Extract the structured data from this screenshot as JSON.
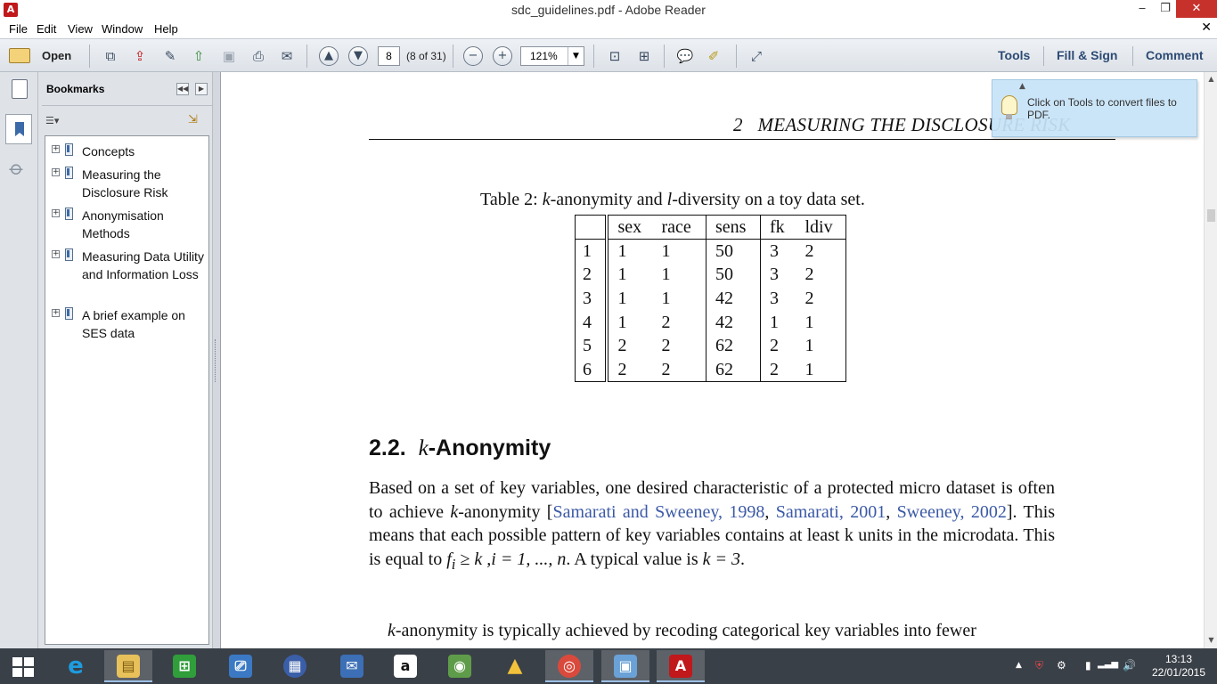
{
  "window": {
    "title": "sdc_guidelines.pdf - Adobe Reader",
    "app_icon_glyph": "A",
    "minimize_glyph": "‒",
    "restore_glyph": "❐",
    "close_glyph": "✕"
  },
  "menu": {
    "items": [
      "File",
      "Edit",
      "View",
      "Window",
      "Help"
    ],
    "close_glyph": "✕"
  },
  "toolbar": {
    "open_label": "Open",
    "page_value": "8",
    "page_count": "(8 of 31)",
    "zoom_value": "121%",
    "zoom_dropdown_glyph": "▼",
    "icons": [
      "create-pdf-icon",
      "export-pdf-icon",
      "edit-icon",
      "upload-icon",
      "save-icon",
      "print-icon",
      "email-icon",
      "previous-page-icon",
      "next-page-icon",
      "zoom-out-icon",
      "zoom-in-icon",
      "fit-page-icon",
      "fit-width-icon",
      "comment-icon",
      "highlight-icon",
      "fullscreen-icon"
    ],
    "glyphs": {
      "prev": "▲",
      "next": "▼",
      "zoom_out": "−",
      "zoom_in": "+",
      "create": "⧉",
      "export": "⇪",
      "edit": "✎",
      "upload": "⇧",
      "save": "▣",
      "print": "⎙",
      "email": "✉",
      "fit_page": "⊡",
      "fit_width": "⊞",
      "comment": "💬",
      "highlight": "✐",
      "fullscreen": "⤢"
    },
    "right_panels": [
      "Tools",
      "Fill & Sign",
      "Comment"
    ]
  },
  "bookmarks": {
    "title": "Bookmarks",
    "collapse_glyph": "◀◀",
    "expand_glyph": "▶",
    "options_glyph": "☰▾",
    "find_glyph": "⇲",
    "expand_item_glyph": "+",
    "items": [
      {
        "label": "Concepts"
      },
      {
        "label": "Measuring the Disclosure Risk"
      },
      {
        "label": "Anonymisation Methods"
      },
      {
        "label": "Measuring Data Utility and Information Loss"
      },
      {
        "label": "A brief example on SES data"
      }
    ]
  },
  "document": {
    "running_head": "2   MEASURING THE DISCLOSURE RISK",
    "caption_prefix": "Table 2: ",
    "caption_k": "k",
    "caption_mid": "-anonymity and ",
    "caption_l": "l",
    "caption_suffix": "-diversity on a toy data set.",
    "table": {
      "headers": [
        "",
        "sex",
        "race",
        "sens",
        "fk",
        "ldiv"
      ],
      "rows": [
        [
          "1",
          "1",
          "1",
          "50",
          "3",
          "2"
        ],
        [
          "2",
          "1",
          "1",
          "50",
          "3",
          "2"
        ],
        [
          "3",
          "1",
          "1",
          "42",
          "3",
          "2"
        ],
        [
          "4",
          "1",
          "2",
          "42",
          "1",
          "1"
        ],
        [
          "5",
          "2",
          "2",
          "62",
          "2",
          "1"
        ],
        [
          "6",
          "2",
          "2",
          "62",
          "2",
          "1"
        ]
      ]
    },
    "section_number": "2.2.",
    "section_k": "k",
    "section_title": "-Anonymity",
    "para1": {
      "t1": "Based on a set of key variables, one desired characteristic of a protected micro dataset is often to achieve ",
      "k": "k",
      "t2": "-anonymity [",
      "cite1": "Samarati and Sweeney, 1998",
      "sep1": ", ",
      "cite2": "Samarati, 2001",
      "sep2": ", ",
      "cite3": "Sweeney, 2002",
      "t3": "]. This means that each possible pattern of key variables contains at least k units in the microdata. This is equal to ",
      "math": "f",
      "math_sub": "i",
      "math2": " ≥ k ,i = 1, ..., n",
      "t4": ". A typical value is ",
      "math3": "k = 3",
      "t5": "."
    },
    "para2": {
      "k": "k",
      "t1": "-anonymity is typically achieved by recoding categorical key variables into fewer"
    }
  },
  "tooltip": {
    "text": "Click on Tools to convert files to PDF.",
    "close_glyph": "▲"
  },
  "scrollbar": {
    "up_glyph": "▲",
    "down_glyph": "▼"
  },
  "taskbar": {
    "apps": [
      {
        "name": "internet-explorer",
        "glyph": "e",
        "color": "#1e9ce0"
      },
      {
        "name": "file-explorer",
        "glyph": "▤",
        "color": "#e8c15a"
      },
      {
        "name": "store",
        "glyph": "⊞",
        "color": "#2f9e3b"
      },
      {
        "name": "remote-desktop",
        "glyph": "⎚",
        "color": "#3b79c4"
      },
      {
        "name": "calculator",
        "glyph": "▦",
        "color": "#3a5fa8"
      },
      {
        "name": "messaging",
        "glyph": "✉",
        "color": "#3c6fb5"
      },
      {
        "name": "amazon",
        "glyph": "a",
        "color": "#ffffff"
      },
      {
        "name": "evernote",
        "glyph": "◉",
        "color": "#5f9c4a"
      },
      {
        "name": "google-drive",
        "glyph": "▲",
        "color": "#1ea362"
      },
      {
        "name": "chrome",
        "glyph": "◎",
        "color": "#d94a3c"
      },
      {
        "name": "photos",
        "glyph": "▣",
        "color": "#6aa1d6"
      },
      {
        "name": "adobe-reader",
        "glyph": "A",
        "color": "#c0181b"
      }
    ],
    "tray_glyphs": [
      "▲",
      "⛨",
      "⚙",
      "▮",
      "▂▃▅",
      "🔊"
    ],
    "time": "13:13",
    "date": "22/01/2015"
  }
}
